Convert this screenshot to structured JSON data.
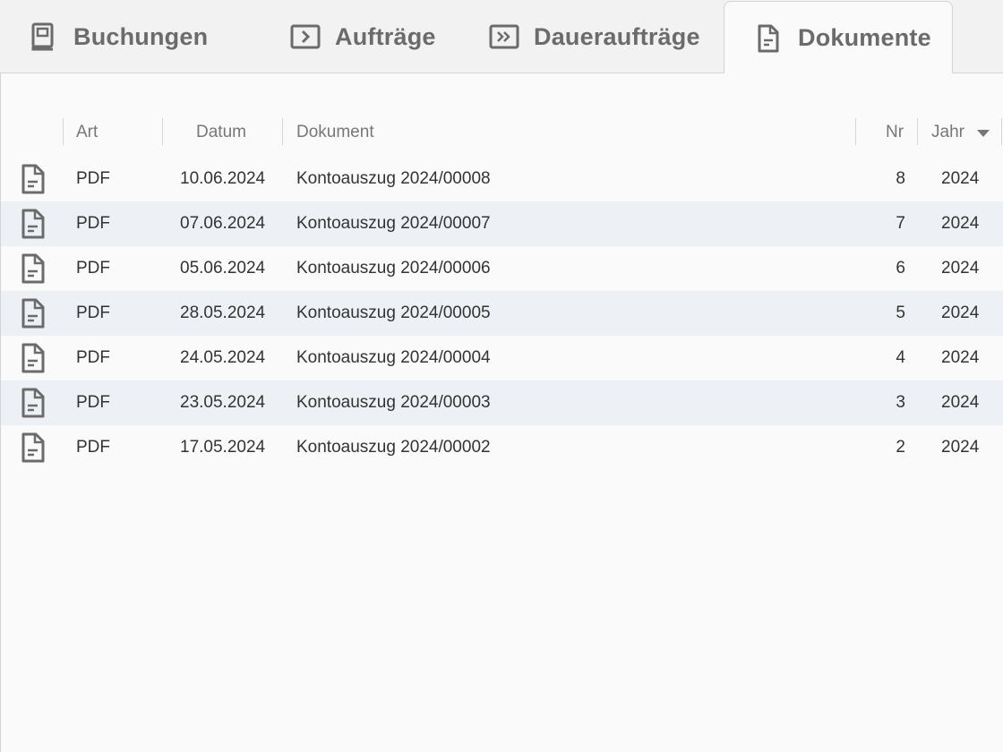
{
  "tabs": [
    {
      "id": "buchungen",
      "label": "Buchungen",
      "icon": "book-icon"
    },
    {
      "id": "auftraege",
      "label": "Aufträge",
      "icon": "chevron-right-box-icon"
    },
    {
      "id": "dauerauftraege",
      "label": "Daueraufträge",
      "icon": "double-chevron-right-box-icon"
    },
    {
      "id": "dokumente",
      "label": "Dokumente",
      "icon": "document-icon",
      "active": true
    }
  ],
  "table": {
    "headers": {
      "art": "Art",
      "datum": "Datum",
      "dokument": "Dokument",
      "nr": "Nr",
      "jahr": "Jahr"
    },
    "sort": {
      "column": "jahr",
      "direction": "descending"
    },
    "rows": [
      {
        "icon": "document-icon",
        "art": "PDF",
        "datum": "10.06.2024",
        "dokument": "Kontoauszug 2024/00008",
        "nr": "8",
        "jahr": "2024"
      },
      {
        "icon": "document-icon",
        "art": "PDF",
        "datum": "07.06.2024",
        "dokument": "Kontoauszug 2024/00007",
        "nr": "7",
        "jahr": "2024"
      },
      {
        "icon": "document-icon",
        "art": "PDF",
        "datum": "05.06.2024",
        "dokument": "Kontoauszug 2024/00006",
        "nr": "6",
        "jahr": "2024"
      },
      {
        "icon": "document-icon",
        "art": "PDF",
        "datum": "28.05.2024",
        "dokument": "Kontoauszug 2024/00005",
        "nr": "5",
        "jahr": "2024"
      },
      {
        "icon": "document-icon",
        "art": "PDF",
        "datum": "24.05.2024",
        "dokument": "Kontoauszug 2024/00004",
        "nr": "4",
        "jahr": "2024"
      },
      {
        "icon": "document-icon",
        "art": "PDF",
        "datum": "23.05.2024",
        "dokument": "Kontoauszug 2024/00003",
        "nr": "3",
        "jahr": "2024"
      },
      {
        "icon": "document-icon",
        "art": "PDF",
        "datum": "17.05.2024",
        "dokument": "Kontoauszug 2024/00002",
        "nr": "2",
        "jahr": "2024"
      }
    ]
  },
  "colors": {
    "tab_text": "#6b6b6b",
    "icon": "#6b6b6b",
    "row_alt": "#edf1f5",
    "panel_bg": "#fafafa",
    "tabbar_bg": "#f2f2f2"
  }
}
